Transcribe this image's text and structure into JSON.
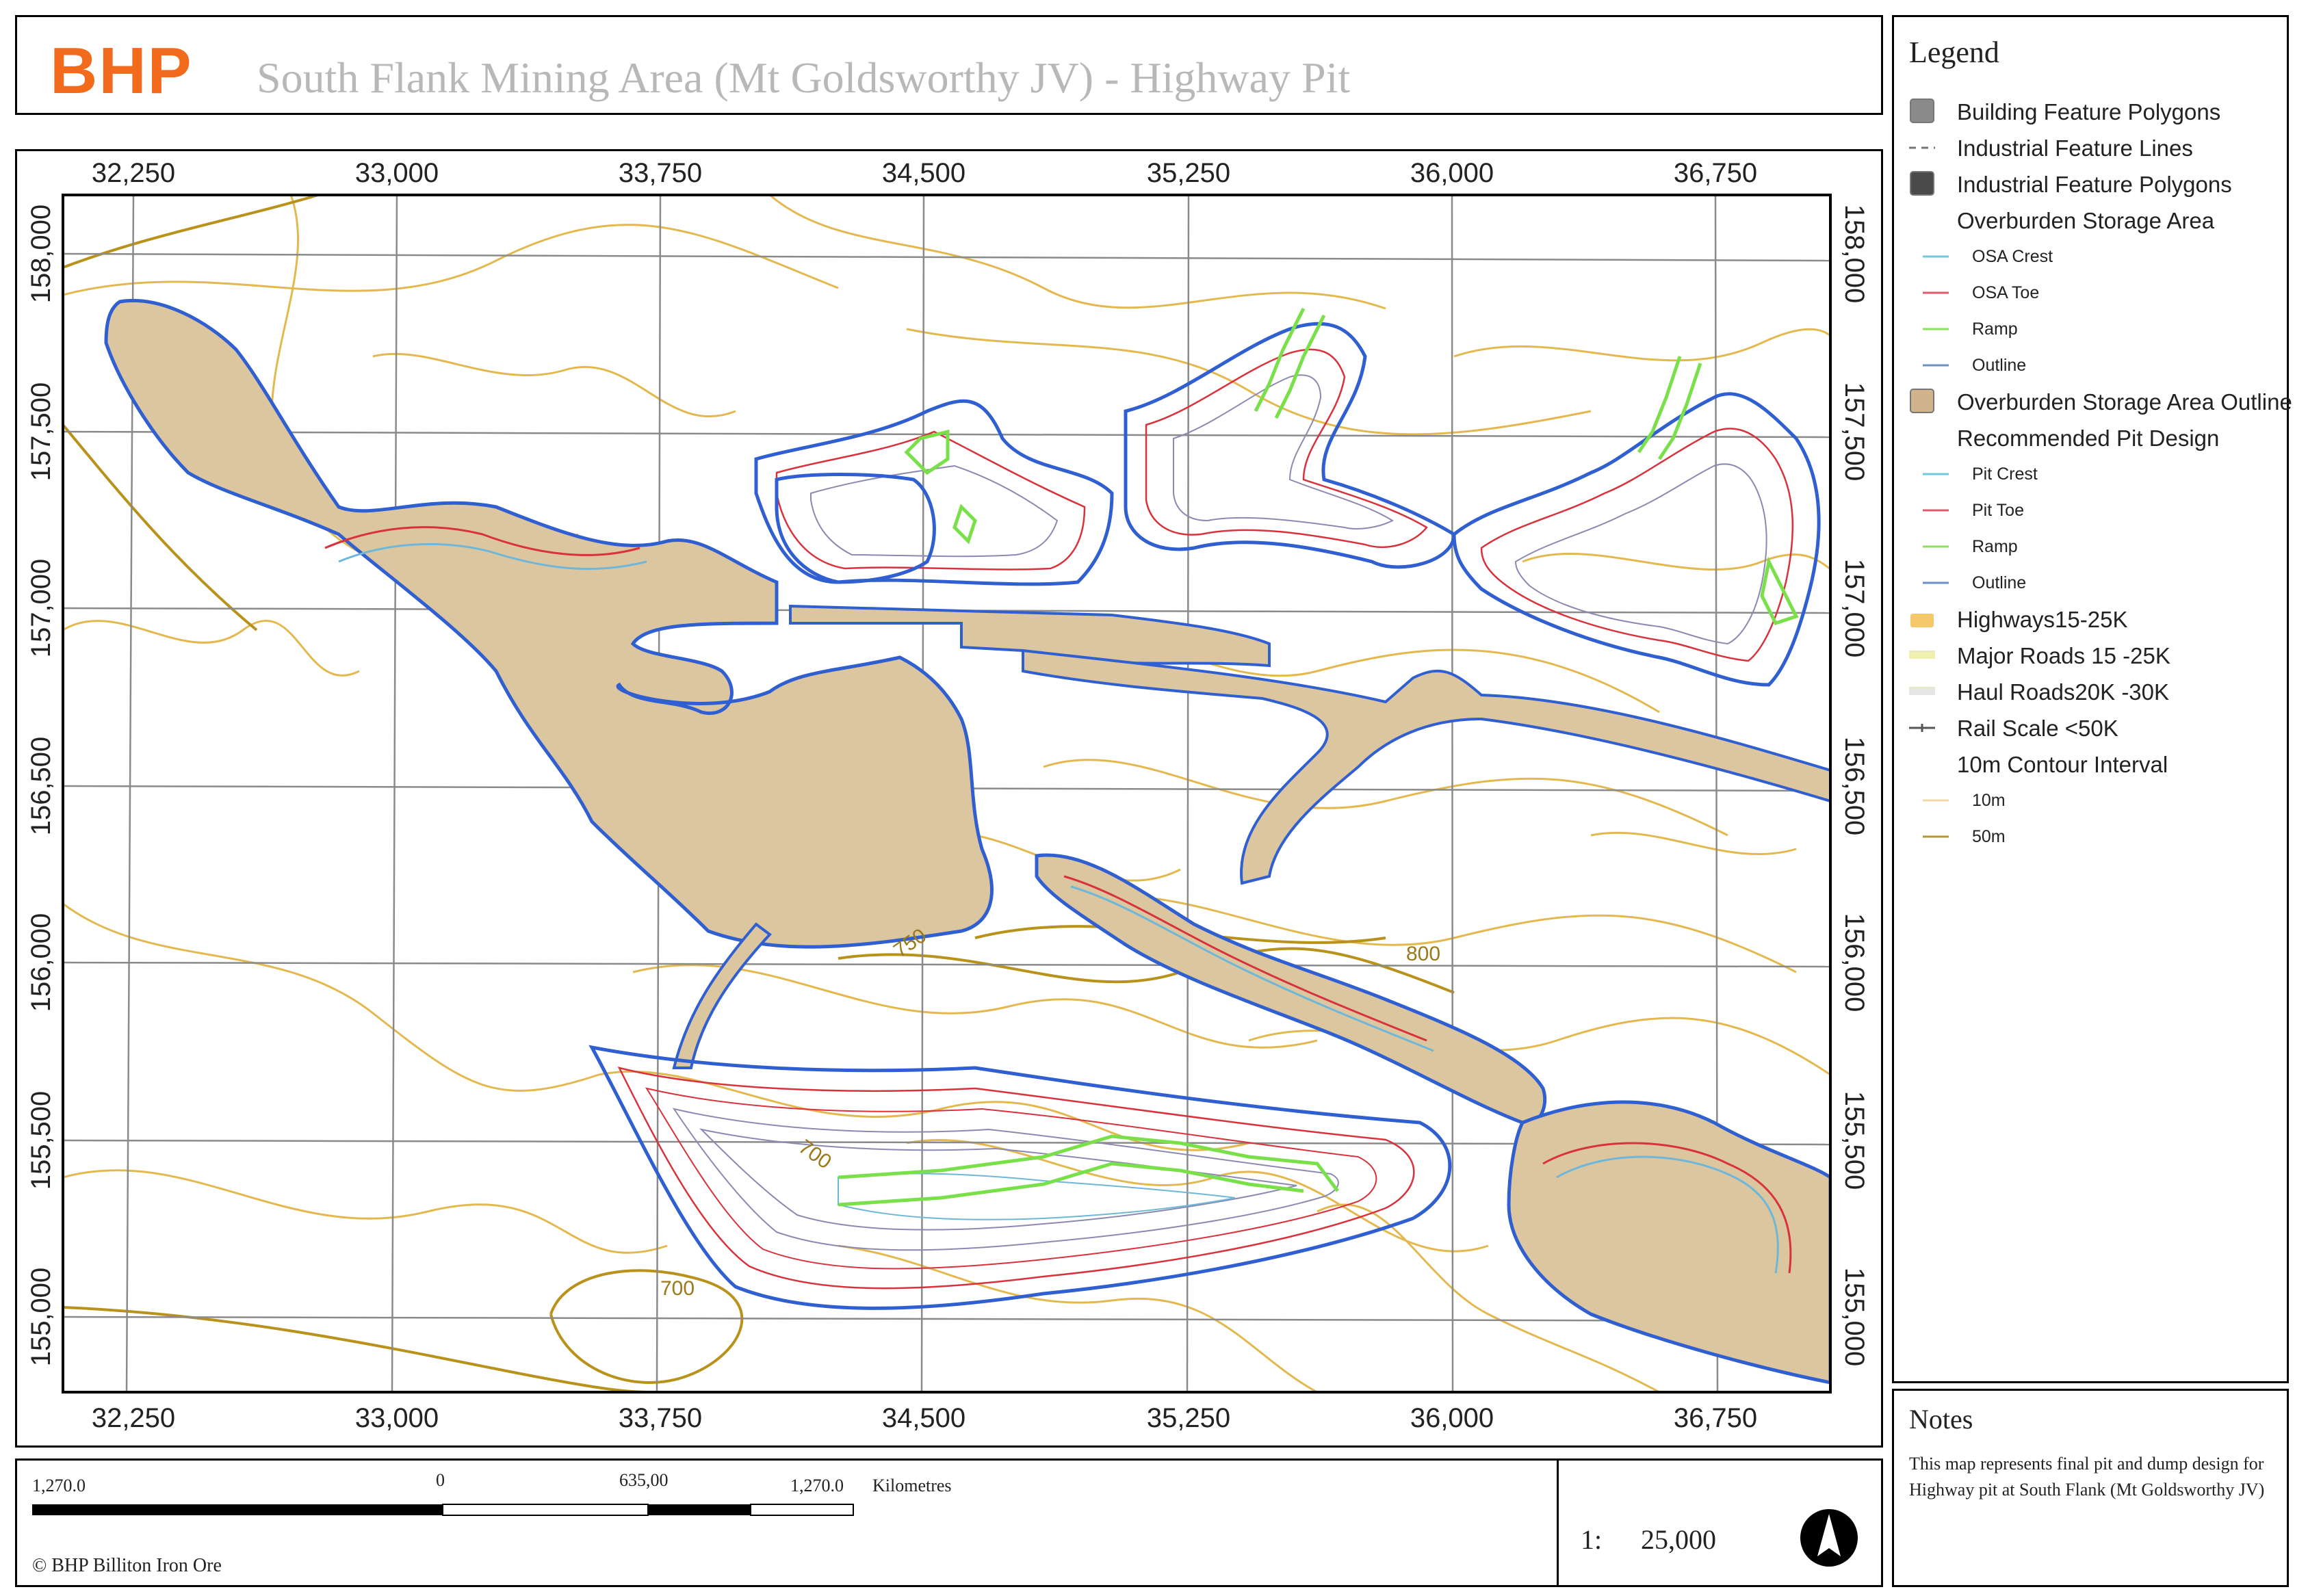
{
  "header": {
    "logo_text": "BHP",
    "title": "South Flank Mining Area (Mt Goldsworthy JV) - Highway Pit"
  },
  "map": {
    "x_ticks": [
      "32,250",
      "33,000",
      "33,750",
      "34,500",
      "35,250",
      "36,000",
      "36,750"
    ],
    "y_ticks": [
      "158,000",
      "157,500",
      "157,000",
      "156,500",
      "156,000",
      "155,500",
      "155,000"
    ],
    "contour_labels": [
      "750",
      "800",
      "700",
      "700"
    ],
    "colors": {
      "fill": "#dcc6a0",
      "outline": "#2f5fd0",
      "crest": "#6fb7d8",
      "toe": "#d8323c",
      "ramp": "#79e04a",
      "contour10": "#e3b94f",
      "contour50": "#b8921a",
      "grid": "#8a8a8a"
    }
  },
  "legend": {
    "title": "Legend",
    "items": [
      {
        "label": "Building Feature Polygons",
        "kind": "box",
        "color": "#8a8a8a",
        "level": "main"
      },
      {
        "label": "Industrial Feature Lines",
        "kind": "dash",
        "color": "#777777",
        "level": "main"
      },
      {
        "label": "Industrial Feature Polygons",
        "kind": "box",
        "color": "#4a4a4a",
        "level": "main"
      },
      {
        "label": "Overburden Storage Area",
        "kind": "none",
        "color": "",
        "level": "main"
      },
      {
        "label": "OSA Crest",
        "kind": "line",
        "color": "#6fc7e0",
        "level": "sub"
      },
      {
        "label": "OSA Toe",
        "kind": "line",
        "color": "#e05a6a",
        "level": "sub"
      },
      {
        "label": "Ramp",
        "kind": "line",
        "color": "#8de060",
        "level": "sub"
      },
      {
        "label": "Outline",
        "kind": "line",
        "color": "#6d8fc8",
        "level": "sub"
      },
      {
        "label": "Overburden Storage Area Outline",
        "kind": "box",
        "color": "#d2b48c",
        "level": "main"
      },
      {
        "label": "Recommended Pit Design",
        "kind": "none",
        "color": "",
        "level": "main"
      },
      {
        "label": "Pit Crest",
        "kind": "line",
        "color": "#6fc7e0",
        "level": "sub"
      },
      {
        "label": "Pit Toe",
        "kind": "line",
        "color": "#e05a6a",
        "level": "sub"
      },
      {
        "label": "Ramp",
        "kind": "line",
        "color": "#8de060",
        "level": "sub"
      },
      {
        "label": "Outline",
        "kind": "line",
        "color": "#6d8fc8",
        "level": "sub"
      },
      {
        "label": "Highways15-25K",
        "kind": "box-small",
        "color": "#f5c86a",
        "level": "main"
      },
      {
        "label": "Major Roads 15   -25K",
        "kind": "thick",
        "color": "#f1efb0",
        "level": "main"
      },
      {
        "label": "Haul Roads20K   -30K",
        "kind": "thick",
        "color": "#e6e6e6",
        "level": "main"
      },
      {
        "label": "Rail Scale <50K",
        "kind": "rail",
        "color": "#555555",
        "level": "main"
      },
      {
        "label": "10m Contour Interval",
        "kind": "none",
        "color": "",
        "level": "main"
      },
      {
        "label": "10m",
        "kind": "line",
        "color": "#f2d9a6",
        "level": "sub"
      },
      {
        "label": "50m",
        "kind": "line",
        "color": "#b8962a",
        "level": "sub"
      }
    ]
  },
  "notes": {
    "title": "Notes",
    "text": "This map represents final pit and dump design for Highway pit at South Flank (Mt Goldsworthy JV)"
  },
  "footer": {
    "scale_labels": [
      "1,270.0",
      "0",
      "635,00",
      "1,270.0"
    ],
    "scale_unit": "Kilometres",
    "copyright": "© BHP Billiton Iron Ore",
    "ratio_prefix": "1:",
    "ratio_value": "25,000"
  }
}
